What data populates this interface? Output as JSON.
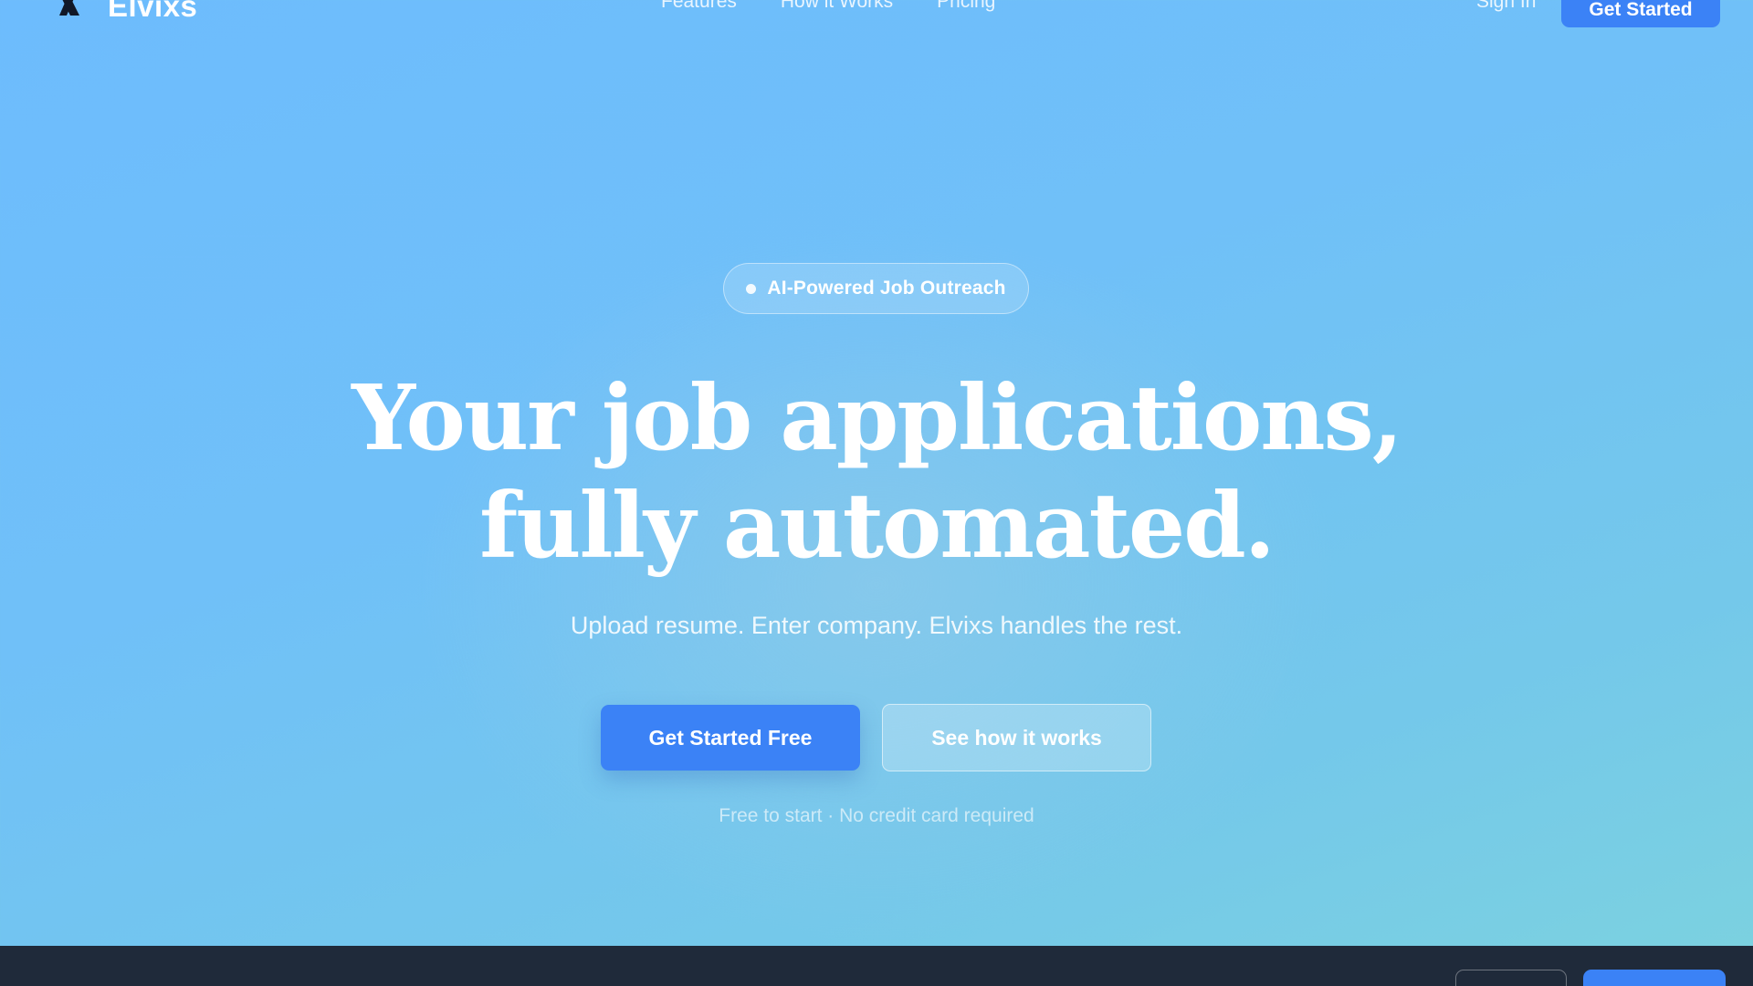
{
  "nav": {
    "logo_icon": "x-logo-icon",
    "logo_text": "Elvixs",
    "links": [
      "Features",
      "How it Works",
      "Pricing"
    ],
    "sign_in": "Sign In",
    "cta": "Get Started"
  },
  "hero": {
    "badge": "AI-Powered Job Outreach",
    "headline_line1": "Your job applications,",
    "headline_line2": "fully automated.",
    "subtitle": "Upload resume. Enter company. Elvixs handles the rest.",
    "primary_cta": "Get Started Free",
    "secondary_cta": "See how it works",
    "fineprint": "Free to start · No credit card required"
  },
  "colors": {
    "accent": "#3b82f6",
    "bottom_bar": "#1f2a3a"
  }
}
